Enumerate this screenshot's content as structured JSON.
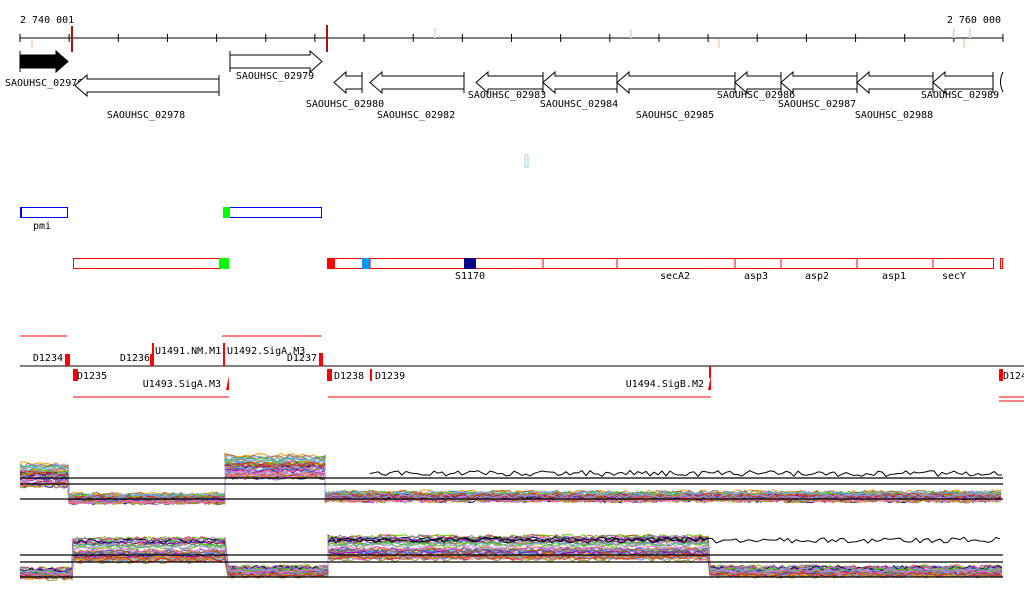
{
  "ruler": {
    "start_label": "2 740 001",
    "end_label": "2 760 000"
  },
  "genes": [
    {
      "name": "SAOUHSC_02976",
      "strand": "+",
      "filled": true
    },
    {
      "name": "SAOUHSC_02978",
      "strand": "-"
    },
    {
      "name": "SAOUHSC_02979",
      "strand": "+"
    },
    {
      "name": "SAOUHSC_02980",
      "strand": "-"
    },
    {
      "name": "SAOUHSC_02982",
      "strand": "-"
    },
    {
      "name": "SAOUHSC_02983",
      "strand": "-"
    },
    {
      "name": "SAOUHSC_02984",
      "strand": "-"
    },
    {
      "name": "SAOUHSC_02985",
      "strand": "-"
    },
    {
      "name": "SAOUHSC_02986",
      "strand": "-"
    },
    {
      "name": "SAOUHSC_02987",
      "strand": "-"
    },
    {
      "name": "SAOUHSC_02988",
      "strand": "-"
    },
    {
      "name": "SAOUHSC_02989",
      "strand": "-"
    }
  ],
  "features_blue": [
    {
      "label": "pmi"
    },
    {
      "label": ""
    }
  ],
  "features_red": {
    "labels": [
      "S1170",
      "secA2",
      "asp3",
      "asp2",
      "asp1",
      "secY"
    ]
  },
  "transcripts": {
    "labels": [
      "D1234",
      "D1235",
      "D1236",
      "U1491.NM.M1",
      "U1492.SigA.M3",
      "D1237",
      "U1493.SigA.M3",
      "D1238",
      "D1239",
      "U1494.SigB.M2",
      "D124"
    ]
  },
  "colors": {
    "accent_red": "#ff0000",
    "dark_red": "#aa1111",
    "pink_mark": "#f8d8c8",
    "blue": "#0000ff",
    "green": "#00ff00",
    "light_blue": "#0099ff",
    "navy": "#000088",
    "series": [
      "#e0602a",
      "#66cc00",
      "#990099",
      "#3366cc",
      "#66b3ff",
      "#996633",
      "#999933",
      "#ff66cc",
      "#cc3333",
      "#9999dd",
      "#000066",
      "#cc9933",
      "#33aa66",
      "#ff9900",
      "#aa66cc"
    ]
  },
  "expression": {
    "panels": [
      {
        "segment_levels": [
          0.7,
          0.15,
          0.9,
          0.2
        ],
        "outlier_level": 0.75
      },
      {
        "segment_levels": [
          0.15,
          0.7,
          0.2,
          0.75,
          0.2
        ],
        "outlier_level": 0.95
      }
    ]
  }
}
